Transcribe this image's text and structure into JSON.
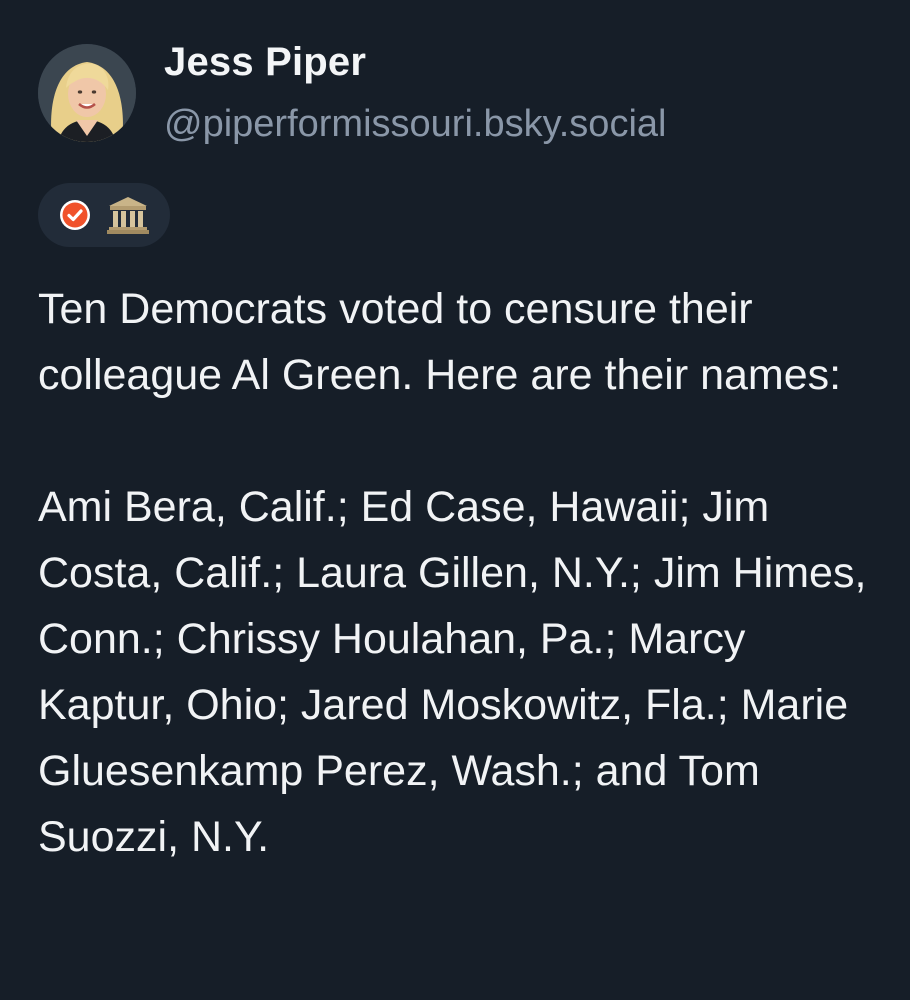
{
  "post": {
    "author": {
      "display_name": "Jess Piper",
      "handle": "@piperformissouri.bsky.social",
      "avatar_icon": "user-avatar-photo"
    },
    "badges": [
      {
        "icon": "verified-check-icon",
        "color": "#f0522b"
      },
      {
        "icon": "government-building-icon",
        "color": "#b8a27a"
      }
    ],
    "text_intro": "Ten Democrats voted to censure their colleague Al Green. Here are their names:",
    "text_names": "Ami Bera, Calif.; Ed Case, Hawaii; Jim Costa, Calif.; Laura Gillen, N.Y.; Jim Himes, Conn.; Chrissy Houlahan, Pa.; Marcy Kaptur, Ohio; Jared Moskowitz, Fla.; Marie Gluesenkamp Perez, Wash.; and Tom Suozzi, N.Y."
  },
  "colors": {
    "background": "#161e28",
    "text": "#f1f3f5",
    "handle_text": "#8a97a8",
    "badge_pill": "#222c39"
  }
}
